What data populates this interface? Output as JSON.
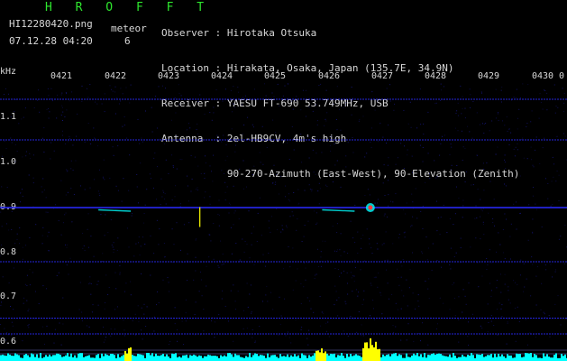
{
  "header": {
    "title": "H R O F F T",
    "filename": "HI12280420.png",
    "detection_label": "meteor",
    "datetime": "07.12.28 04:20",
    "detection_count": "6",
    "meta_lines": [
      "Observer : Hirotaka Otsuka",
      "Location : Hirakata, Osaka, Japan (135.7E, 34.9N)",
      "Receiver : YAESU FT-690 53.749MHz, USB",
      "Antenna  : 2el-HB9CV, 4m's high",
      "           90-270-Azimuth (East-West), 90-Elevation (Zenith)"
    ]
  },
  "colors": {
    "background": "#000000",
    "title": "#2ee62e",
    "text": "#d8d8d8",
    "grid_blue": "#2a2aff",
    "signal_yellow": "#ffff00",
    "signal_cyan": "#00ffff",
    "signal_red": "#ff3b3b"
  },
  "chart_data": {
    "type": "spectrogram",
    "unit_label": "kHz",
    "x_ticks": [
      "0421",
      "0422",
      "0423",
      "0424",
      "0425",
      "0426",
      "0427",
      "0428",
      "0429",
      "0430"
    ],
    "x_end_label": "0",
    "y_ticks": [
      "1.1",
      "1.0",
      "0.9",
      "0.8",
      "0.7",
      "0.6"
    ],
    "ylim": [
      0.6,
      1.15
    ],
    "grid_lines_khz": [
      1.14,
      1.05,
      0.9,
      0.78,
      0.655,
      0.62
    ],
    "echoes": [
      {
        "minute": 4.22,
        "khz": 0.895,
        "kind": "trace"
      },
      {
        "minute": 4.236,
        "khz": 0.885,
        "kind": "vertical"
      },
      {
        "minute": 4.262,
        "khz": 0.895,
        "kind": "trace"
      },
      {
        "minute": 4.268,
        "khz": 0.9,
        "kind": "head"
      }
    ]
  }
}
